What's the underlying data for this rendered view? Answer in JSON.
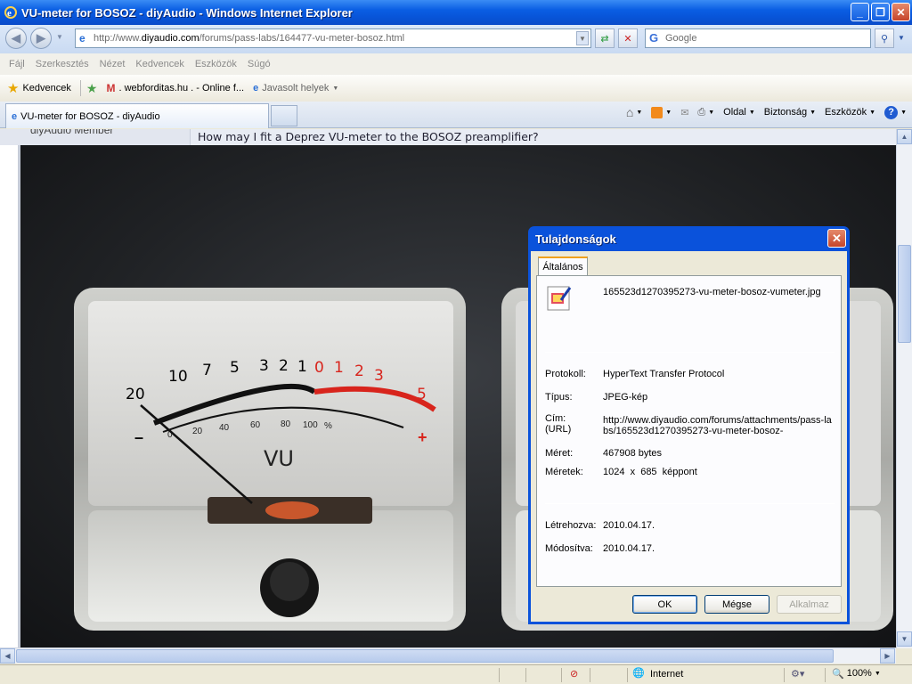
{
  "window": {
    "title": "VU-meter for BOSOZ - diyAudio - Windows Internet Explorer"
  },
  "address": {
    "url_prefix": "http://www.",
    "url_domain": "diyaudio.com",
    "url_path": "/forums/pass-labs/164477-vu-meter-bosoz.html"
  },
  "search": {
    "placeholder": "Google"
  },
  "menu": [
    "Fájl",
    "Szerkesztés",
    "Nézet",
    "Kedvencek",
    "Eszközök",
    "Súgó"
  ],
  "favorites": {
    "label": "Kedvencek",
    "items": [
      ". webforditas.hu . - Online f...",
      "Javasolt helyek"
    ]
  },
  "tab": {
    "label": "VU-meter for BOSOZ - diyAudio"
  },
  "commands": [
    "Oldal",
    "Biztonság",
    "Eszközök"
  ],
  "page": {
    "member": "diyAudio Member",
    "question": "How may I fit a Deprez VU-meter to the BOSOZ preamplifier?"
  },
  "dialog": {
    "title": "Tulajdonságok",
    "tab": "Általános",
    "filename": "165523d1270395273-vu-meter-bosoz-vumeter.jpg",
    "rows": [
      {
        "label": "Protokoll:",
        "value": "HyperText Transfer Protocol"
      },
      {
        "label": "Típus:",
        "value": "JPEG-kép"
      },
      {
        "label": "Cím:\n(URL)",
        "value": "http://www.diyaudio.com/forums/attachments/pass-labs/165523d1270395273-vu-meter-bosoz-"
      },
      {
        "label": "Méret:",
        "value": "467908 bytes"
      },
      {
        "label": "Méretek:",
        "value": "1024  x  685  képpont"
      },
      {
        "label": "Létrehozva:",
        "value": "2010.04.17."
      },
      {
        "label": "Módosítva:",
        "value": "2010.04.17."
      }
    ],
    "ok": "OK",
    "cancel": "Mégse",
    "apply": "Alkalmaz"
  },
  "meter": {
    "scale_black": [
      "20",
      "10",
      "7",
      "5",
      "3",
      "2",
      "1"
    ],
    "scale_red": [
      "0",
      "1",
      "2",
      "3",
      "5"
    ],
    "percent": [
      "0",
      "20",
      "40",
      "60",
      "80",
      "100",
      "%"
    ],
    "label": "VU",
    "minus": "–",
    "plus": "+"
  },
  "status": {
    "zone": "Internet",
    "zoom": "100%"
  }
}
